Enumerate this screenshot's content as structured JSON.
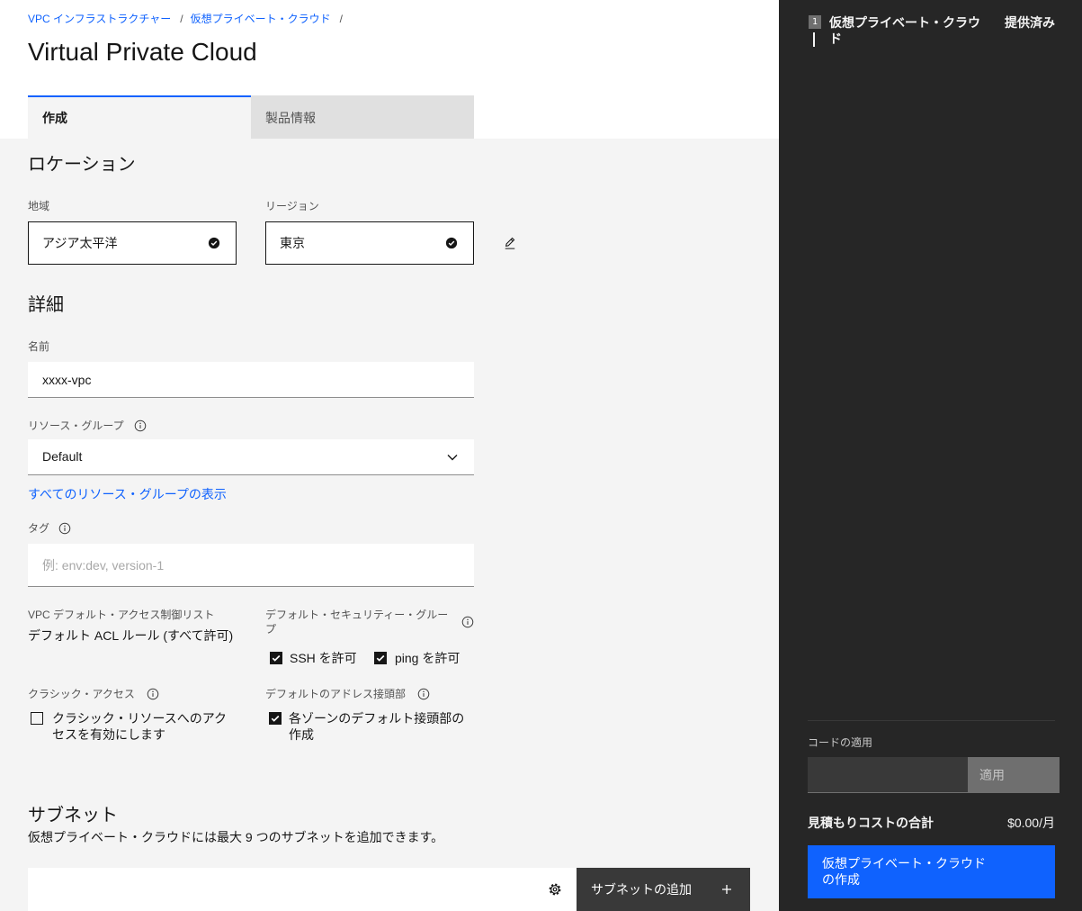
{
  "colors": {
    "accent": "#0f62fe",
    "content-bg": "#f4f4f4",
    "sidebar-bg": "#262626",
    "text-primary": "#161616",
    "text-secondary": "#525252"
  },
  "breadcrumb": {
    "items": [
      "VPC インフラストラクチャー",
      "仮想プライベート・クラウド"
    ],
    "separator": "/"
  },
  "page_title": "Virtual Private Cloud",
  "tabs": [
    {
      "label": "作成",
      "selected": true
    },
    {
      "label": "製品情報",
      "selected": false
    }
  ],
  "location": {
    "heading": "ロケーション",
    "geography": {
      "label": "地域",
      "value": "アジア太平洋",
      "status_icon": "checkmark-filled-icon"
    },
    "region": {
      "label": "リージョン",
      "value": "東京",
      "status_icon": "checkmark-filled-icon"
    },
    "edit_icon": "edit-pencil-icon"
  },
  "details": {
    "heading": "詳細",
    "name": {
      "label": "名前",
      "value": "xxxx-vpc"
    },
    "resource_group": {
      "label": "リソース・グループ",
      "value": "Default",
      "info_icon": "information-icon",
      "view_all_link": "すべてのリソース・グループの表示"
    },
    "tags": {
      "label": "タグ",
      "placeholder": "例: env:dev, version-1",
      "info_icon": "information-icon"
    },
    "acl": {
      "label": "VPC デフォルト・アクセス制御リスト",
      "value": "デフォルト ACL ルール (すべて許可)"
    },
    "security_group": {
      "label": "デフォルト・セキュリティー・グループ",
      "info_icon": "information-icon",
      "options": [
        {
          "label": "SSH を許可",
          "checked": true
        },
        {
          "label": "ping を許可",
          "checked": true
        }
      ]
    },
    "classic_access": {
      "label": "クラシック・アクセス",
      "info_icon": "information-icon",
      "option": {
        "label": "クラシック・リソースへのアクセスを有効にします",
        "checked": false
      }
    },
    "address_prefix": {
      "label": "デフォルトのアドレス接頭部",
      "info_icon": "information-icon",
      "option": {
        "label": "各ゾーンのデフォルト接頭部の作成",
        "checked": true
      }
    }
  },
  "subnets": {
    "heading": "サブネット",
    "description": "仮想プライベート・クラウドには最大 9 つのサブネットを追加できます。",
    "settings_icon": "settings-gear-icon",
    "add_button": "サブネットの追加",
    "add_icon": "add-plus-icon"
  },
  "summary": {
    "step": {
      "number": "1",
      "title": "仮想プライベート・クラウド",
      "status": "提供済み"
    },
    "promo": {
      "label": "コードの適用",
      "apply_button": "適用"
    },
    "total": {
      "label": "見積もりコストの合計",
      "value": "$0.00/月"
    },
    "create_button": "仮想プライベート・クラウドの作成"
  }
}
